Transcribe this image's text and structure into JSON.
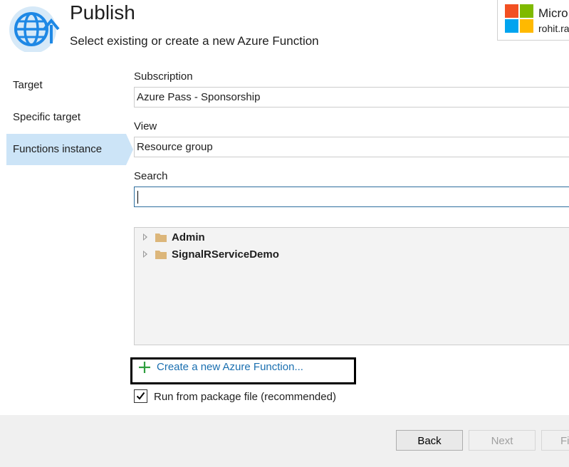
{
  "header": {
    "title": "Publish",
    "subtitle": "Select existing or create a new Azure Function",
    "icon": "globe-publish-icon"
  },
  "account": {
    "name": "Micro",
    "email": "rohit.ra",
    "logo_colors": [
      "#f25022",
      "#7fba00",
      "#00a4ef",
      "#ffb900"
    ]
  },
  "nav": {
    "items": [
      {
        "label": "Target"
      },
      {
        "label": "Specific target"
      },
      {
        "label": "Functions instance",
        "active": true
      }
    ]
  },
  "form": {
    "subscription": {
      "label": "Subscription",
      "value": "Azure Pass - Sponsorship"
    },
    "view": {
      "label": "View",
      "value": "Resource group"
    },
    "search": {
      "label": "Search",
      "value": ""
    }
  },
  "tree": {
    "items": [
      {
        "label": "Admin"
      },
      {
        "label": "SignalRServiceDemo"
      }
    ]
  },
  "create_link": {
    "label": "Create a new Azure Function..."
  },
  "run_from_package": {
    "label": "Run from package file (recommended)",
    "checked": true
  },
  "footer": {
    "back_label": "Back",
    "next_label": "Next",
    "finish_label": "Fi"
  },
  "colors": {
    "accent": "#1a6fb0",
    "nav_active": "#cce4f7",
    "icon_blue": "#1e88e5"
  }
}
